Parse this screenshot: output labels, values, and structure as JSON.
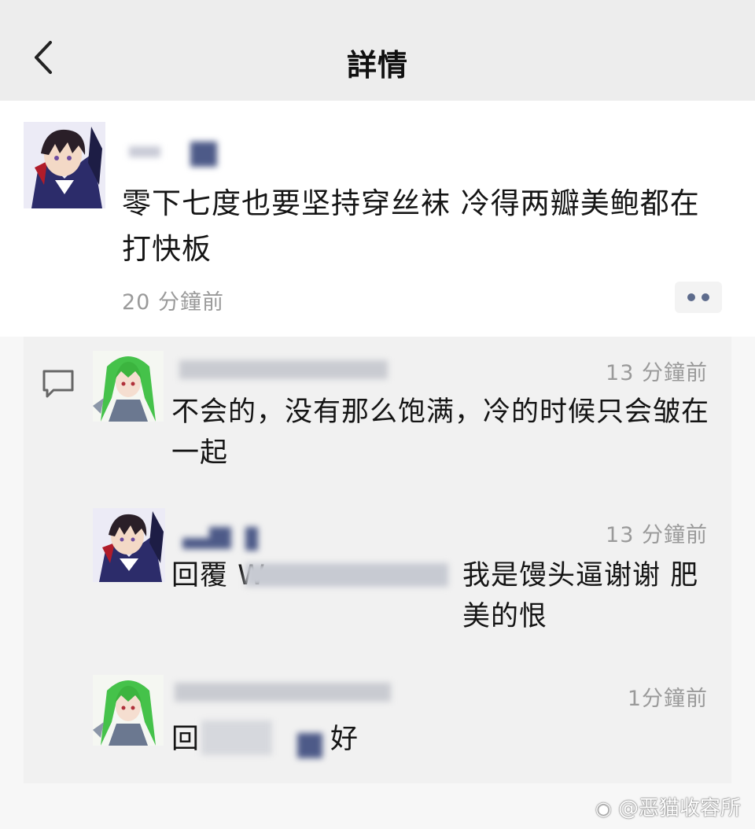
{
  "header": {
    "title": "詳情"
  },
  "post": {
    "text": "零下七度也要坚持穿丝袜 冷得两瓣美鲍都在打快板",
    "time": "20 分鐘前"
  },
  "comments": [
    {
      "time": "13 分鐘前",
      "text": "不会的，没有那么饱满，冷的时候只会皱在一起"
    },
    {
      "time": "13 分鐘前",
      "reply_prefix": "回覆 W",
      "text": "我是馒头逼谢谢 肥美的恨"
    },
    {
      "time": "1分鐘前",
      "reply_prefix": "回",
      "text": "好"
    }
  ],
  "watermark": "@恶猫收容所",
  "icons": [
    "back-chevron-icon",
    "more-dots-icon",
    "comment-icon",
    "weibo-icon"
  ],
  "colors": {
    "header_bg": "#ededed",
    "comment_bg": "#f1f1f1",
    "link_blue": "#5d6b8c"
  }
}
